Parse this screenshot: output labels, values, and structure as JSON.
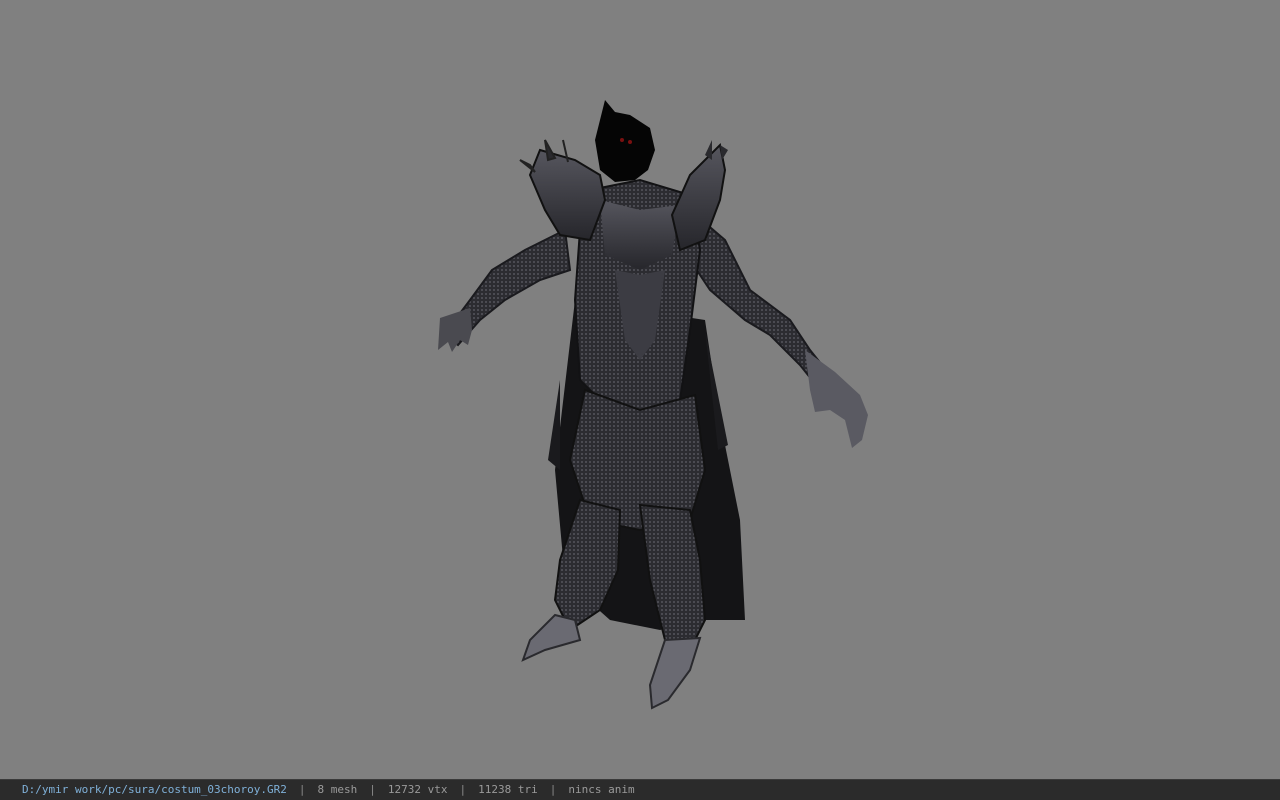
{
  "viewport": {
    "background_color": "#808080",
    "model_description_icon": "armored-character-model"
  },
  "statusbar": {
    "file_path": "D:/ymir work/pc/sura/costum_03choroy.GR2",
    "separator": "|",
    "mesh_count": "8 mesh",
    "vertex_count": "12732 vtx",
    "triangle_count": "11238 tri",
    "anim_status": "nincs anim",
    "path_color": "#7fb0d8",
    "text_color": "#9a9a9a",
    "bar_color": "#2b2b2b"
  }
}
